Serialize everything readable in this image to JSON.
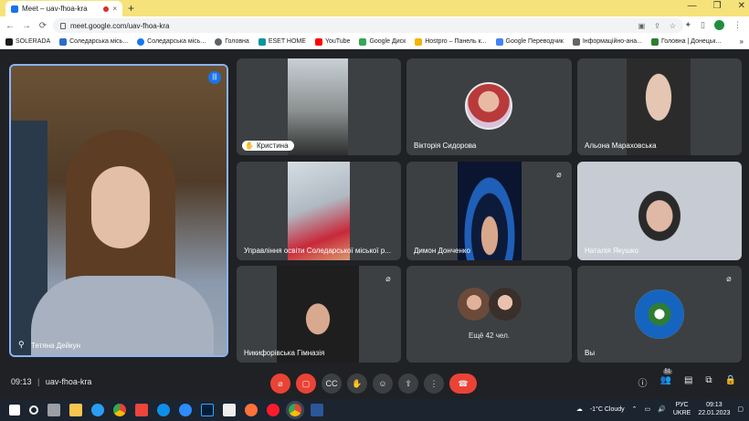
{
  "browser": {
    "tab_title": "Meet – uav-fhoa-kra",
    "tab_close": "×",
    "new_tab": "+",
    "url": "meet.google.com/uav-fhoa-kra",
    "bookmarks": [
      "SOLERADA",
      "Соледарська місь...",
      "Соледарська місь...",
      "Головна",
      "ESET HOME",
      "YouTube",
      "Google Диск",
      "Hostpro – Панель к...",
      "Google Переводчик",
      "Інформаційно-ана...",
      "Головна | Донецьк..."
    ],
    "bookmarks_more": "»",
    "win_min": "—",
    "win_max": "❐",
    "win_close": "✕"
  },
  "meet": {
    "main_speaker": "Тетяна Дейкун",
    "tiles": [
      {
        "name": "Кристина"
      },
      {
        "name": "Вікторія Сидорова"
      },
      {
        "name": "Альона Мараховська"
      },
      {
        "name": "Управління освіти Соледарської міської р..."
      },
      {
        "name": "Димон Донченко"
      },
      {
        "name": "Наталія Якушко"
      },
      {
        "name": "Никифорівська Гімназія"
      },
      {
        "name": "Ещё 42 чел."
      },
      {
        "name": "Вы"
      }
    ],
    "time": "09:13",
    "separator": "|",
    "meeting_code": "uav-fhoa-kra",
    "participants_count": "51"
  },
  "taskbar": {
    "weather": "-1°C  Cloudy",
    "lang_top": "РУС",
    "lang_bottom": "UKRE",
    "clock_time": "09:13",
    "clock_date": "22.01.2023"
  },
  "colors": {
    "accent": "#8ab4f8",
    "end_call": "#ea4335",
    "meet_bg": "#202124",
    "tile_bg": "#3c4043"
  }
}
